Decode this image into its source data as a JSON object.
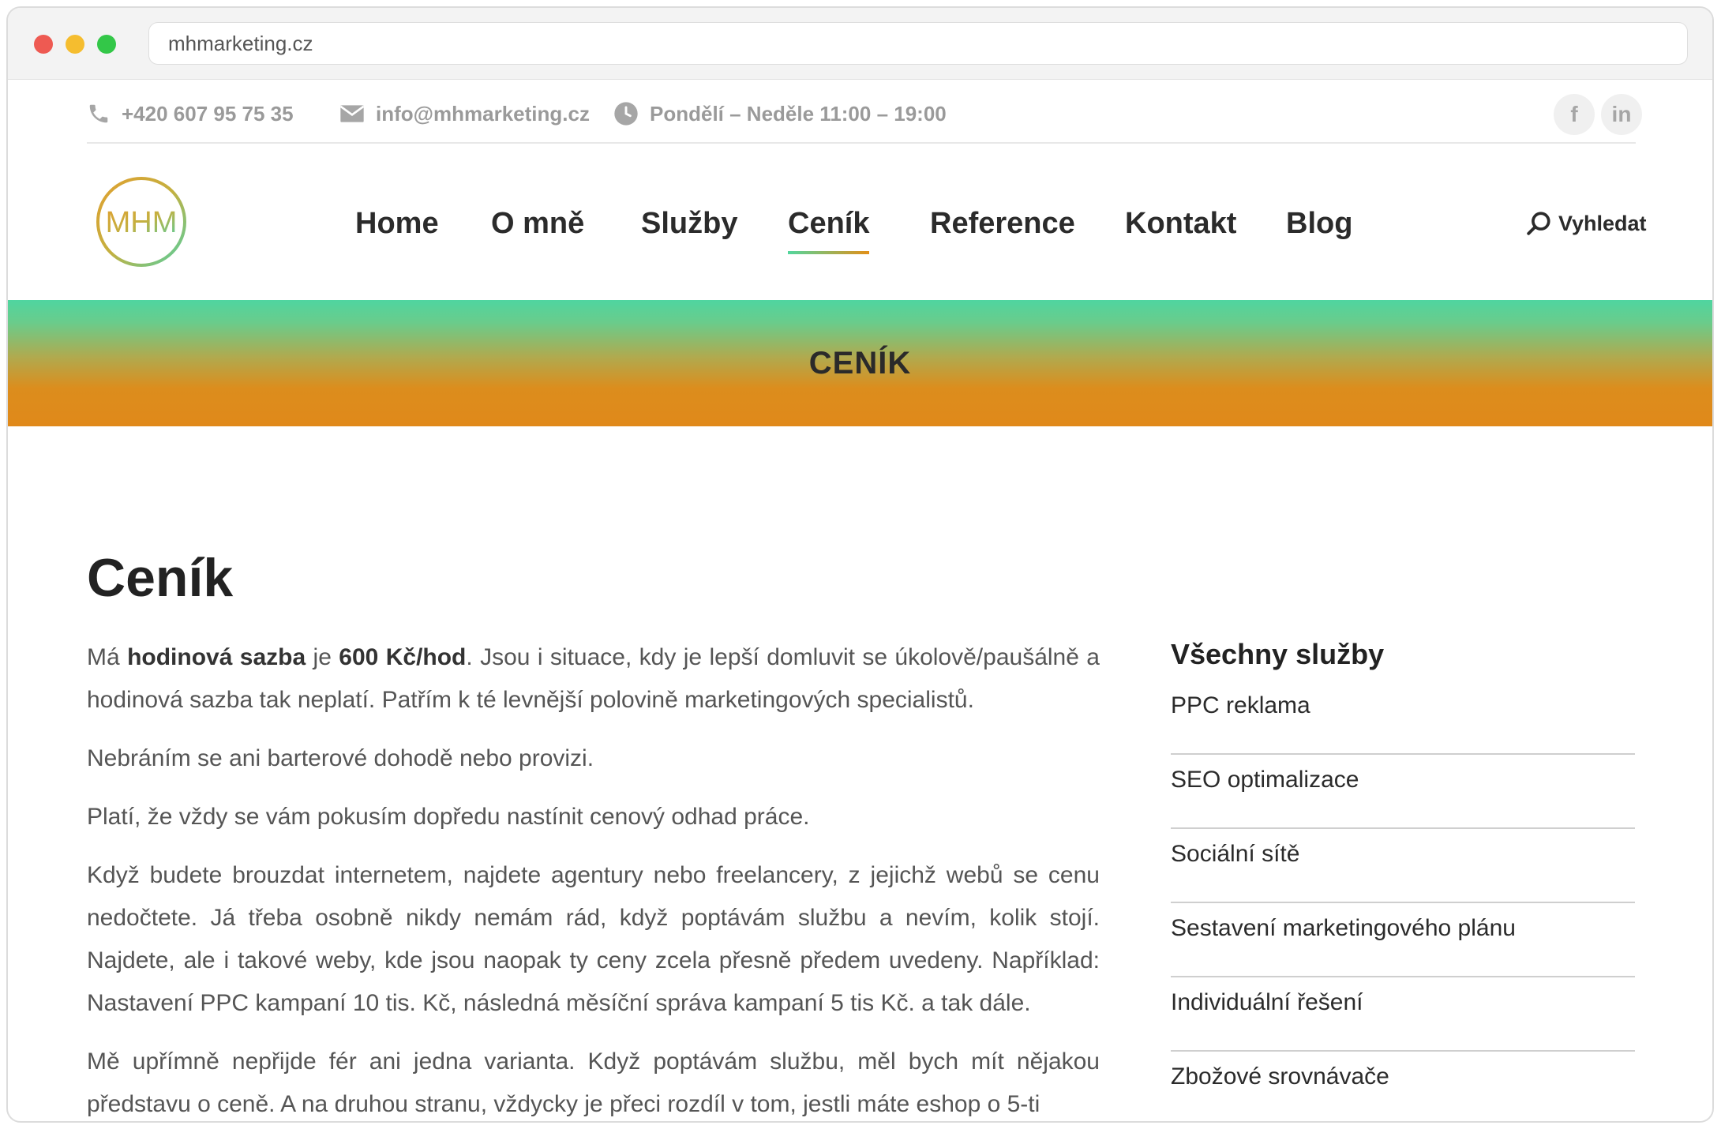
{
  "browser": {
    "url": "mhmarketing.cz"
  },
  "topbar": {
    "phone": "+420 607 95 75 35",
    "email": "info@mhmarketing.cz",
    "hours": "Pondělí – Neděle 11:00 – 19:00",
    "social": [
      {
        "icon": "facebook-icon",
        "label": "f"
      },
      {
        "icon": "linkedin-icon",
        "label": "in"
      }
    ]
  },
  "header": {
    "logo_text": "MHM",
    "nav": [
      {
        "label": "Home",
        "active": false
      },
      {
        "label": "O mně",
        "active": false
      },
      {
        "label": "Služby",
        "active": false
      },
      {
        "label": "Ceník",
        "active": true
      },
      {
        "label": "Reference",
        "active": false
      },
      {
        "label": "Kontakt",
        "active": false
      },
      {
        "label": "Blog",
        "active": false
      }
    ],
    "search_label": "Vyhledat"
  },
  "banner": {
    "title": "CENÍK"
  },
  "main": {
    "title": "Ceník",
    "p1": {
      "t1": "Má ",
      "b1": "hodinová sazba",
      "t2": " je ",
      "b2": "600 Kč/hod",
      "t3": ". Jsou i situace, kdy je lepší domluvit se úkolově/paušálně a hodinová sazba tak neplatí. Patřím k té levnější polovině marketingových specialistů."
    },
    "p2": "Nebráním se ani barterové dohodě nebo provizi.",
    "p3": "Platí, že vždy se vám pokusím dopředu nastínit cenový odhad práce.",
    "p4": "Když budete brouzdat internetem, najdete agentury nebo freelancery, z jejichž webů se cenu nedočtete. Já třeba osobně nikdy nemám rád, když poptávám službu a nevím, kolik stojí. Najdete, ale i takové weby, kde jsou naopak ty ceny zcela přesně předem uvedeny. Například: Nastavení PPC kampaní 10 tis. Kč, následná měsíční správa kampaní 5 tis Kč. a tak dále.",
    "p5": "Mě upřímně nepřijde fér ani jedna varianta. Když poptávám službu, měl bych mít nějakou představu o ceně. A na druhou stranu, vždycky je přeci rozdíl v tom, jestli máte eshop o 5-ti"
  },
  "sidebar": {
    "title": "Všechny služby",
    "items": [
      "PPC reklama",
      "SEO optimalizace",
      "Sociální sítě",
      "Sestavení marketingového plánu",
      "Individuální řešení",
      "Zbožové srovnávače"
    ]
  },
  "colors": {
    "accent_green": "#52d69e",
    "accent_orange": "#e0891a",
    "text_dark": "#2b2b2b",
    "text_muted": "#9a9a9a"
  }
}
